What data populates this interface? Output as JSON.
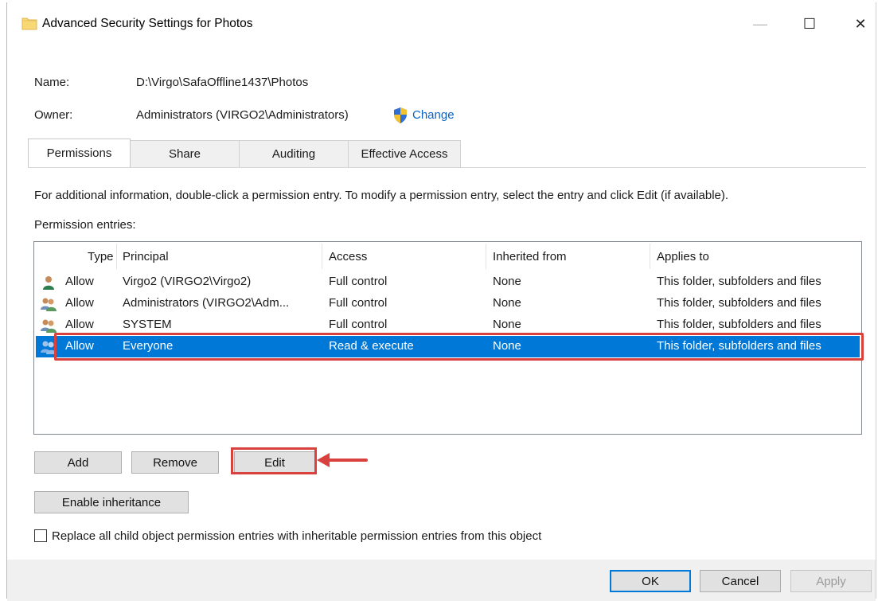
{
  "window": {
    "title": "Advanced Security Settings for Photos",
    "minimize_glyph": "—",
    "maximize_glyph": "☐",
    "close_glyph": "✕"
  },
  "details": {
    "name_label": "Name:",
    "name_value": "D:\\Virgo\\SafaOffline1437\\Photos",
    "owner_label": "Owner:",
    "owner_value": "Administrators (VIRGO2\\Administrators)",
    "change_link": "Change"
  },
  "tabs": [
    {
      "label": "Permissions",
      "active": true
    },
    {
      "label": "Share",
      "active": false
    },
    {
      "label": "Auditing",
      "active": false
    },
    {
      "label": "Effective Access",
      "active": false
    }
  ],
  "info_text": "For additional information, double-click a permission entry. To modify a permission entry, select the entry and click Edit (if available).",
  "entries_label": "Permission entries:",
  "table": {
    "columns": [
      "Type",
      "Principal",
      "Access",
      "Inherited from",
      "Applies to"
    ],
    "rows": [
      {
        "icon": "single-user-icon",
        "type": "Allow",
        "principal": "Virgo2 (VIRGO2\\Virgo2)",
        "access": "Full control",
        "inherited": "None",
        "applies": "This folder, subfolders and files",
        "selected": false
      },
      {
        "icon": "group-users-icon",
        "type": "Allow",
        "principal": "Administrators (VIRGO2\\Adm...",
        "access": "Full control",
        "inherited": "None",
        "applies": "This folder, subfolders and files",
        "selected": false
      },
      {
        "icon": "group-users-icon",
        "type": "Allow",
        "principal": "SYSTEM",
        "access": "Full control",
        "inherited": "None",
        "applies": "This folder, subfolders and files",
        "selected": false
      },
      {
        "icon": "group-users-icon",
        "type": "Allow",
        "principal": "Everyone",
        "access": "Read & execute",
        "inherited": "None",
        "applies": "This folder, subfolders and files",
        "selected": true
      }
    ]
  },
  "buttons": {
    "add": "Add",
    "remove": "Remove",
    "edit": "Edit",
    "enable_inheritance": "Enable inheritance",
    "ok": "OK",
    "cancel": "Cancel",
    "apply": "Apply"
  },
  "replace_checkbox_label": "Replace all child object permission entries with inheritable permission entries from this object",
  "colors": {
    "selection": "#0078d7",
    "annotation": "#d9413f",
    "link": "#0a62c6"
  }
}
